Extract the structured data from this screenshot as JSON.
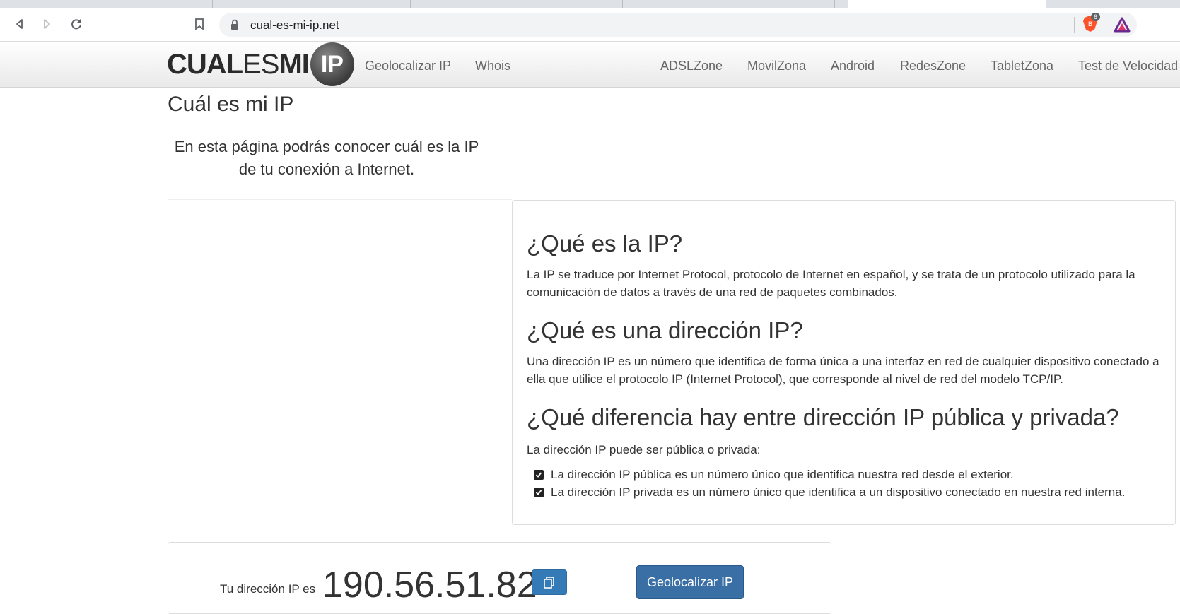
{
  "browser": {
    "url": "cual-es-mi-ip.net",
    "brave_badge_count": "6"
  },
  "site": {
    "logo": {
      "part1": "CUAL",
      "part2": "ES",
      "part3": "MI",
      "part4": "IP"
    },
    "nav_left": [
      "Geolocalizar IP",
      "Whois"
    ],
    "nav_right": [
      "ADSLZone",
      "MovilZona",
      "Android",
      "RedesZone",
      "TabletZona",
      "Test de Velocidad"
    ]
  },
  "main": {
    "title": "Cuál es mi IP",
    "intro": "En esta página podrás conocer cuál es la IP de tu conexión a Internet."
  },
  "panel": {
    "h1": "¿Qué es la IP?",
    "p1": "La IP se traduce por Internet Protocol, protocolo de Internet en español, y se trata de un protocolo utilizado para la comunicación de datos a través de una red de paquetes combinados.",
    "h2": "¿Qué es una dirección IP?",
    "p2": "Una dirección IP es un número que identifica de forma única a una interfaz en red de cualquier dispositivo conectado a ella que utilice el protocolo IP (Internet Protocol), que corresponde al nivel de red del modelo TCP/IP.",
    "h3": "¿Qué diferencia hay entre dirección IP pública y privada?",
    "p3": "La dirección IP puede ser pública o privada:",
    "items": [
      "La dirección IP pública es un número único que identifica nuestra red desde el exterior.",
      "La dirección IP privada es un número único que identifica a un dispositivo conectado en nuestra red interna."
    ]
  },
  "ip_box": {
    "label": "Tu dirección IP es",
    "ip": "190.56.51.82",
    "button": "Geolocalizar IP"
  }
}
